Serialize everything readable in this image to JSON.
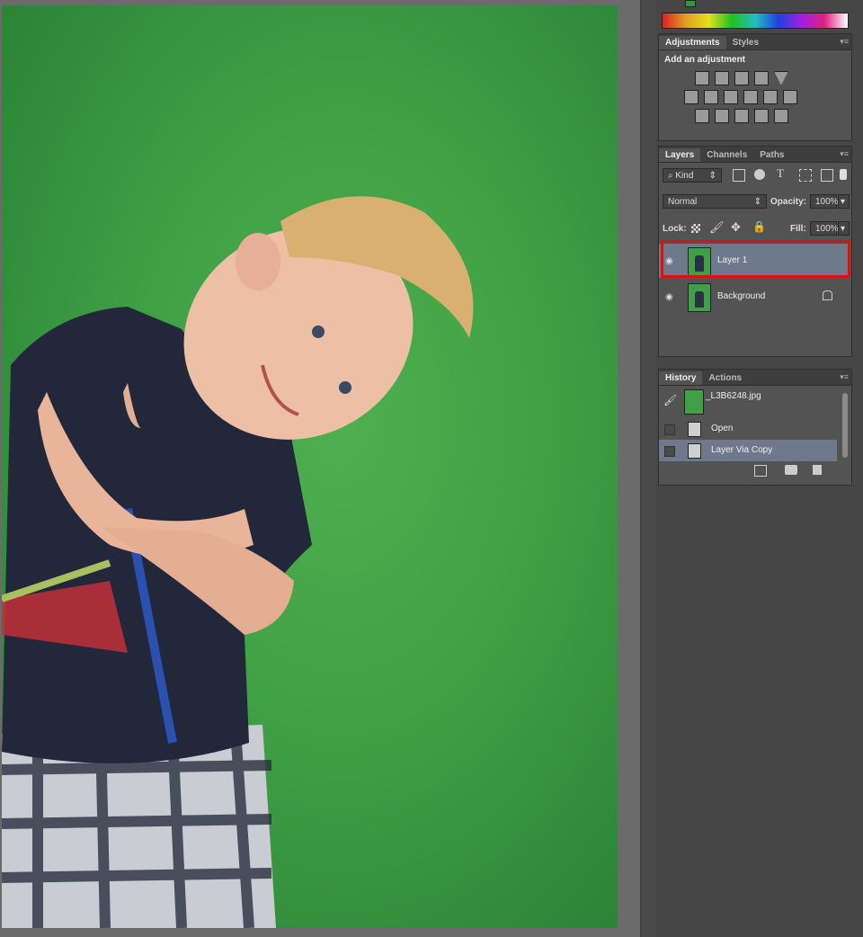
{
  "adjustments_panel": {
    "tab_adjustments": "Adjustments",
    "tab_styles": "Styles",
    "heading": "Add an adjustment"
  },
  "layers_panel": {
    "tab_layers": "Layers",
    "tab_channels": "Channels",
    "tab_paths": "Paths",
    "filter_kind": "Kind",
    "blend_mode": "Normal",
    "opacity_label": "Opacity:",
    "opacity_value": "100%",
    "lock_label": "Lock:",
    "fill_label": "Fill:",
    "fill_value": "100%",
    "layers": [
      {
        "name": "Layer 1",
        "selected": true
      },
      {
        "name": "Background",
        "locked": true
      }
    ]
  },
  "history_panel": {
    "tab_history": "History",
    "tab_actions": "Actions",
    "snapshot": "_L3B6248.jpg",
    "states": [
      "Open",
      "Layer Via Copy"
    ]
  },
  "colors": {
    "highlight": "#e01010",
    "selected_row": "#6e7a8c",
    "panel_bg": "#535353"
  }
}
